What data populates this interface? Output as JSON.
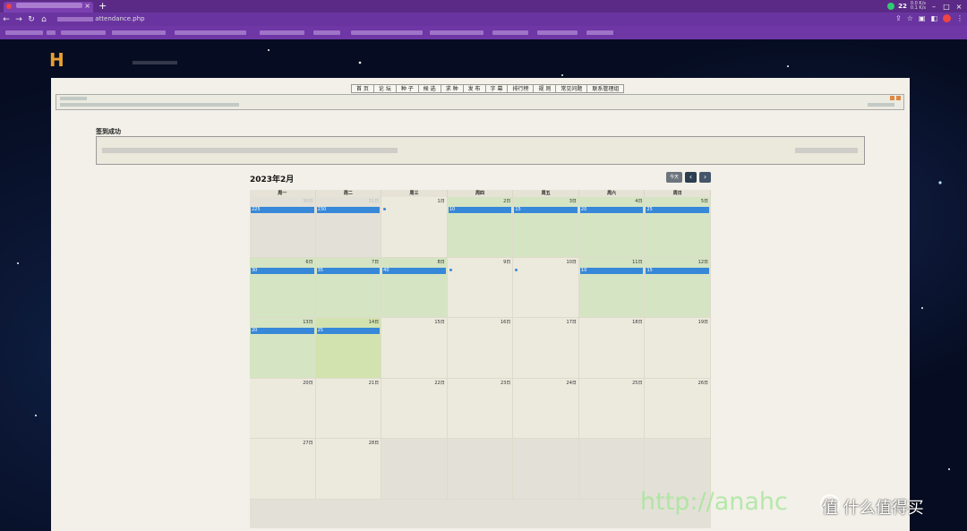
{
  "browser": {
    "new_tab": "+",
    "url": "attendance.php",
    "weather_temp": "22",
    "net_up": "0.0 K/s",
    "net_down": "0.1 K/s"
  },
  "site": {
    "logo": "H",
    "menu": [
      "首 页",
      "论 坛",
      "种 子",
      "候 选",
      "求 种",
      "发 布",
      "字 幕",
      "排行榜",
      "规 则",
      "常见问题",
      "联系管理组"
    ]
  },
  "page": {
    "success_title": "签到成功"
  },
  "calendar": {
    "title": "2023年2月",
    "today_label": "今天",
    "prev": "‹",
    "next": "›",
    "weekdays": [
      "周一",
      "周二",
      "周三",
      "周四",
      "周五",
      "周六",
      "周日"
    ],
    "weeks": [
      [
        {
          "n": "30日",
          "s": "other signed",
          "e": "225"
        },
        {
          "n": "31日",
          "s": "other signed",
          "e": "230"
        },
        {
          "n": "1日",
          "s": "",
          "dot": true
        },
        {
          "n": "2日",
          "s": "signed",
          "e": "10"
        },
        {
          "n": "3日",
          "s": "signed",
          "e": "15"
        },
        {
          "n": "4日",
          "s": "signed",
          "e": "20"
        },
        {
          "n": "5日",
          "s": "signed",
          "e": "25"
        }
      ],
      [
        {
          "n": "6日",
          "s": "signed",
          "e": "30"
        },
        {
          "n": "7日",
          "s": "signed",
          "e": "35"
        },
        {
          "n": "8日",
          "s": "signed",
          "e": "40"
        },
        {
          "n": "9日",
          "s": "",
          "dot": true
        },
        {
          "n": "10日",
          "s": "",
          "dot": true
        },
        {
          "n": "11日",
          "s": "signed",
          "e": "10"
        },
        {
          "n": "12日",
          "s": "signed",
          "e": "15"
        }
      ],
      [
        {
          "n": "13日",
          "s": "signed",
          "e": "20"
        },
        {
          "n": "14日",
          "s": "today",
          "e": "25"
        },
        {
          "n": "15日",
          "s": ""
        },
        {
          "n": "16日",
          "s": ""
        },
        {
          "n": "17日",
          "s": ""
        },
        {
          "n": "18日",
          "s": ""
        },
        {
          "n": "19日",
          "s": ""
        }
      ],
      [
        {
          "n": "20日",
          "s": ""
        },
        {
          "n": "21日",
          "s": ""
        },
        {
          "n": "22日",
          "s": ""
        },
        {
          "n": "23日",
          "s": ""
        },
        {
          "n": "24日",
          "s": ""
        },
        {
          "n": "25日",
          "s": ""
        },
        {
          "n": "26日",
          "s": ""
        }
      ],
      [
        {
          "n": "27日",
          "s": ""
        },
        {
          "n": "28日",
          "s": ""
        },
        {
          "n": "",
          "s": "other"
        },
        {
          "n": "",
          "s": "other"
        },
        {
          "n": "",
          "s": "other"
        },
        {
          "n": "",
          "s": "other"
        },
        {
          "n": "",
          "s": "other"
        }
      ]
    ]
  },
  "watermark": {
    "url": "http://anahc",
    "brand": "值 什么值得买"
  }
}
